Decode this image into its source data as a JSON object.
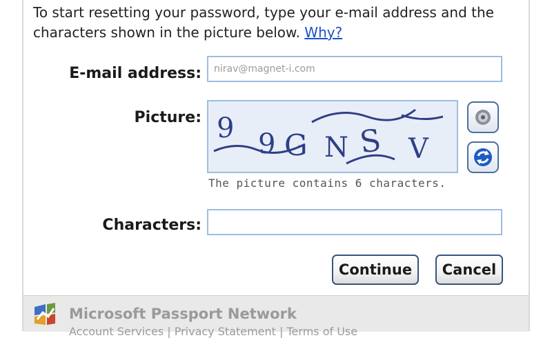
{
  "intro": {
    "text": "To start resetting your password, type your e-mail address and the characters shown in the picture below.",
    "link": "Why?"
  },
  "form": {
    "email_label": "E-mail address:",
    "email_value": "nirav@magnet-i.com",
    "picture_label": "Picture:",
    "captcha_text": "99GNSV",
    "picture_hint": "The picture contains 6 characters.",
    "characters_label": "Characters:",
    "characters_value": ""
  },
  "icons": {
    "audio": "speaker-icon",
    "refresh": "refresh-icon",
    "brand": "passport-logo-icon"
  },
  "buttons": {
    "continue": "Continue",
    "cancel": "Cancel"
  },
  "footer": {
    "title": "Microsoft Passport Network",
    "links": "Account Services | Privacy Statement | Terms of Use"
  },
  "colors": {
    "link": "#1a4fc9",
    "field_border": "#9dbde0",
    "button_border": "#35557e",
    "footer_bg": "#e9e9e9"
  }
}
